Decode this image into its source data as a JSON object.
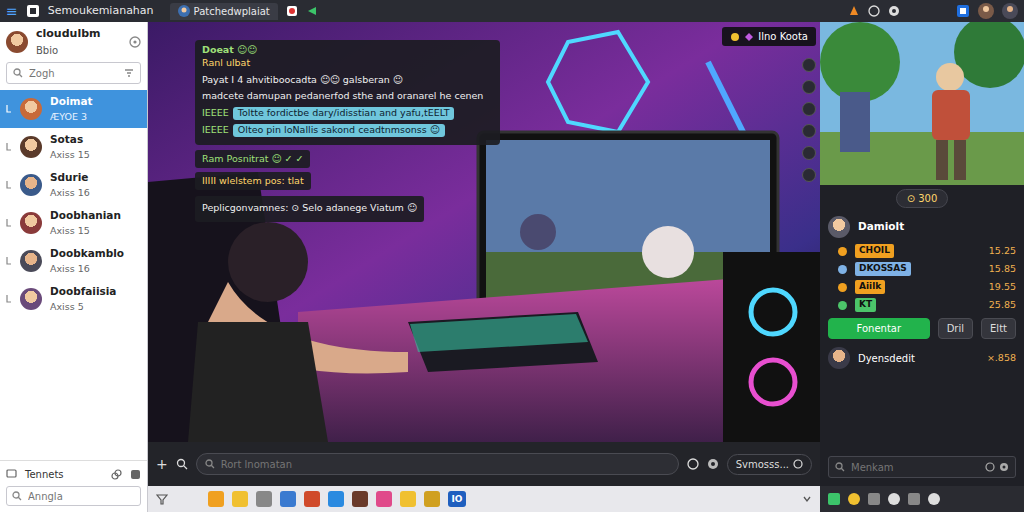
{
  "topbar": {
    "menu_icon": "≡",
    "app_title": "Semoukemianahan",
    "tab_label": "Patchedwplaiat"
  },
  "sidebar": {
    "profile": {
      "name": "cloudulbm",
      "status": "Bbio"
    },
    "search": {
      "placeholder": "Zogh"
    },
    "items": [
      {
        "name": "Doimat",
        "subtitle": "ÆYOE 3",
        "selected": true
      },
      {
        "name": "Sotas",
        "subtitle": "Axiss 15",
        "selected": false
      },
      {
        "name": "Sdurie",
        "subtitle": "Axiss 16",
        "selected": false
      },
      {
        "name": "Doobhanian",
        "subtitle": "Axiss 15",
        "selected": false
      },
      {
        "name": "Doobkamblo",
        "subtitle": "Axiss 16",
        "selected": false
      },
      {
        "name": "Doobfaiisia",
        "subtitle": "Axiss 5",
        "selected": false
      }
    ],
    "footer": {
      "label": "Tennets",
      "field_placeholder": "Anngla"
    }
  },
  "stream": {
    "badge": "Ilno Koota",
    "chat": {
      "title": "Doeat ☺☺",
      "subtitle": "Ranl ulbat",
      "lines": [
        {
          "kind": "text",
          "text": "Payat I 4 ahvitiboocadta ☺☺ galsberan ☺"
        },
        {
          "kind": "text",
          "text": "madcete damupan pedanerfod sthe and oranarel he cenen"
        },
        {
          "kind": "bubble",
          "prefix": "IEEEE",
          "text": "Toltte fordictbe dary/idisstian and yafu,tEELT"
        },
        {
          "kind": "bubble",
          "prefix": "IEEEE",
          "text": "Olteo pin loNallis sakond ceadtnmsonss ☺"
        }
      ]
    },
    "notes": [
      "Ram Posnitrat ☺ ✓ ✓",
      "IIIII wlelstem pos: tlat",
      "Peplicgonvamnes: ⊙ Selo adanege Viatum ☺"
    ]
  },
  "composer": {
    "add_icon": "+",
    "search_placeholder": "Rort lnomatan",
    "hint": "Svmosss...",
    "taskbar_label": "IO"
  },
  "right": {
    "points": "⊙ 300",
    "leader_title": "Damiolt",
    "rows": [
      {
        "label": "CHOIL",
        "value": "15.25",
        "color": "#f0a020"
      },
      {
        "label": "DKOSSAS",
        "value": "15.85",
        "color": "#7fb2e6"
      },
      {
        "label": "Aiilk",
        "value": "19.55",
        "color": "#f0a020"
      },
      {
        "label": "KT",
        "value": "25.85",
        "color": "#4cc46a"
      }
    ],
    "buttons": [
      {
        "label": "Fonentar",
        "primary": true
      },
      {
        "label": "Dril",
        "primary": false
      },
      {
        "label": "Eltt",
        "primary": false
      }
    ],
    "footer_user": {
      "name": "Dyensdedit",
      "value": "×.858"
    },
    "search_placeholder": "Menkam"
  }
}
